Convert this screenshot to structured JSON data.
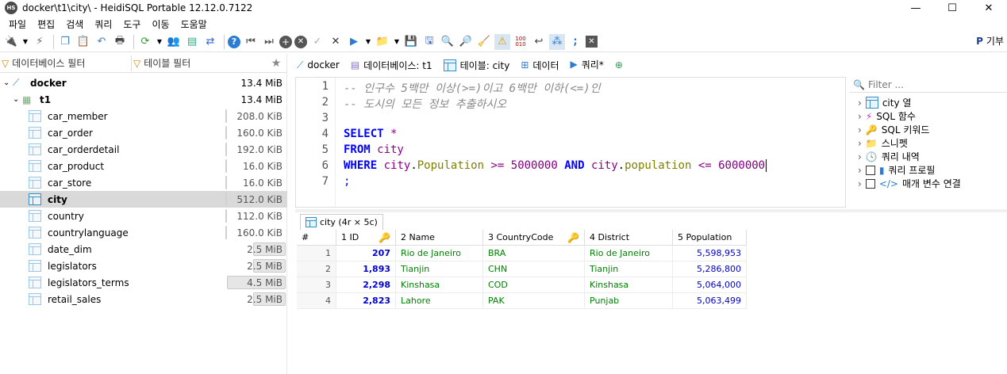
{
  "window": {
    "app_icon_label": "HS",
    "title": "docker\\t1\\city\\ - HeidiSQL Portable 12.12.0.7122",
    "minimize": "—",
    "maximize": "☐",
    "close": "✕"
  },
  "menu": [
    "파일",
    "편집",
    "검색",
    "쿼리",
    "도구",
    "이동",
    "도움말"
  ],
  "toolbar": {
    "right_label": "기부"
  },
  "left": {
    "db_filter": "데이터베이스 필터",
    "table_filter": "테이블 필터",
    "tree": [
      {
        "name": "docker",
        "size": "13.4 MiB",
        "type": "server",
        "fill": 0
      },
      {
        "name": "t1",
        "size": "13.4 MiB",
        "type": "db",
        "fill": 0
      },
      {
        "name": "car_member",
        "size": "208.0 KiB",
        "type": "table",
        "fill": 0
      },
      {
        "name": "car_order",
        "size": "160.0 KiB",
        "type": "table",
        "fill": 0
      },
      {
        "name": "car_orderdetail",
        "size": "192.0 KiB",
        "type": "table",
        "fill": 0
      },
      {
        "name": "car_product",
        "size": "16.0 KiB",
        "type": "table",
        "fill": 0
      },
      {
        "name": "car_store",
        "size": "16.0 KiB",
        "type": "table",
        "fill": 0
      },
      {
        "name": "city",
        "size": "512.0 KiB",
        "type": "table",
        "fill": 0
      },
      {
        "name": "country",
        "size": "112.0 KiB",
        "type": "table",
        "fill": 0
      },
      {
        "name": "countrylanguage",
        "size": "160.0 KiB",
        "type": "table",
        "fill": 0
      },
      {
        "name": "date_dim",
        "size": "2.5 MiB",
        "type": "table",
        "fill": 0.56
      },
      {
        "name": "legislators",
        "size": "2.5 MiB",
        "type": "table",
        "fill": 0.56
      },
      {
        "name": "legislators_terms",
        "size": "4.5 MiB",
        "type": "table",
        "fill": 1.0
      },
      {
        "name": "retail_sales",
        "size": "2.5 MiB",
        "type": "table",
        "fill": 0.56
      }
    ]
  },
  "tabs": [
    {
      "label": "docker",
      "icon": "server-icon"
    },
    {
      "label": "데이터베이스: t1",
      "icon": "database-icon"
    },
    {
      "label": "테이블: city",
      "icon": "table-icon"
    },
    {
      "label": "데이터",
      "icon": "grid-icon"
    },
    {
      "label": "쿼리*",
      "icon": "play-icon"
    }
  ],
  "editor": {
    "line_numbers": [
      "1",
      "2",
      "3",
      "4",
      "5",
      "6",
      "7"
    ],
    "line1": "-- 인구수 5백만 이상(>=)이고 6백만 이하(<=)인",
    "line2": "-- 도시의 모든 정보 추출하시오",
    "select_kw": "SELECT",
    "select_rest": " *",
    "from_kw": "FROM",
    "from_table": " city",
    "where_kw": "WHERE",
    "w_tbl1": " city",
    "w_dot1": ".",
    "w_col1": "Population",
    "w_op1": " >= ",
    "w_val1": "5000000",
    "and_kw": " AND ",
    "w_tbl2": "city",
    "w_dot2": ".",
    "w_col2": "population",
    "w_op2": " <= ",
    "w_val2": "6000000",
    "line7": ";"
  },
  "helper": {
    "filter_placeholder": "Filter ...",
    "items": [
      "city 열",
      "SQL 함수",
      "SQL 키워드",
      "스니펫",
      "쿼리 내역",
      "쿼리 프로필",
      "매개 변수 연결"
    ]
  },
  "result_tab": "city (4r × 5c)",
  "grid": {
    "headers": [
      "#",
      "1 ID",
      "2 Name",
      "3 CountryCode",
      "4 District",
      "5 Population"
    ],
    "rows": [
      [
        "1",
        "207",
        "Rio de Janeiro",
        "BRA",
        "Rio de Janeiro",
        "5,598,953"
      ],
      [
        "2",
        "1,893",
        "Tianjin",
        "CHN",
        "Tianjin",
        "5,286,800"
      ],
      [
        "3",
        "2,298",
        "Kinshasa",
        "COD",
        "Kinshasa",
        "5,064,000"
      ],
      [
        "4",
        "2,823",
        "Lahore",
        "PAK",
        "Punjab",
        "5,063,499"
      ]
    ]
  }
}
